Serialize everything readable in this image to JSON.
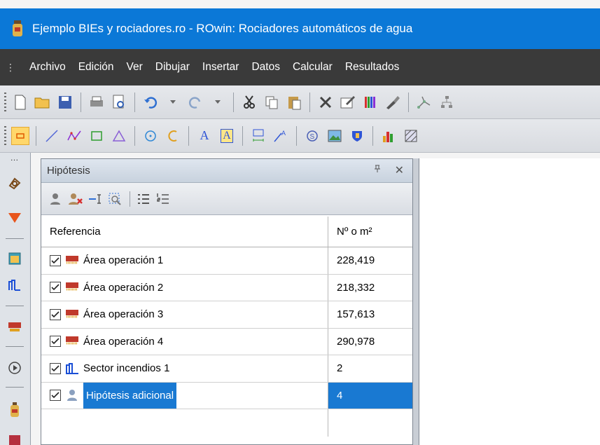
{
  "window": {
    "title": "Ejemplo BIEs y rociadores.ro - ROwin: Rociadores automáticos de agua",
    "icon": "app-extinguisher-icon"
  },
  "menu": {
    "items": [
      "Archivo",
      "Edición",
      "Ver",
      "Dibujar",
      "Insertar",
      "Datos",
      "Calcular",
      "Resultados"
    ]
  },
  "toolbar1": {
    "icons": [
      "new-file-icon",
      "open-folder-icon",
      "save-icon",
      "print-icon",
      "print-preview-icon",
      "undo-icon",
      "redo-icon",
      "cut-icon",
      "copy-icon",
      "paste-icon",
      "delete-icon",
      "edit-icon",
      "colors-icon",
      "brush-icon",
      "network-icon"
    ]
  },
  "toolbar2": {
    "icons": [
      "select-icon",
      "line-icon",
      "polyline-icon",
      "rectangle-icon",
      "triangle-icon",
      "circle-icon",
      "arc-icon",
      "text-icon",
      "text-box-icon",
      "dimension-icon",
      "measure-icon",
      "symbol-icon",
      "image-icon",
      "shield-icon",
      "chart-icon",
      "hatch-icon"
    ]
  },
  "dock": {
    "icons": [
      "layers-icon",
      "funnel-icon",
      "window-icon",
      "sector-icon",
      "operation-area-icon",
      "play-icon",
      "extinguisher-icon",
      "panel-icon"
    ]
  },
  "panel": {
    "title": "Hipótesis",
    "pin": "ᵖ",
    "close": "✕",
    "toolbar_icons": [
      "add-user-icon",
      "remove-user-icon",
      "insert-icon",
      "zoom-selection-icon",
      "list-icon",
      "numbered-list-icon"
    ],
    "columns": [
      "Referencia",
      "Nº o m²"
    ],
    "rows": [
      {
        "label": "Área operación 1",
        "value": "228,419",
        "icon": "operation-area-icon",
        "selected": false
      },
      {
        "label": "Área operación 2",
        "value": "218,332",
        "icon": "operation-area-icon",
        "selected": false
      },
      {
        "label": "Área operación 3",
        "value": "157,613",
        "icon": "operation-area-icon",
        "selected": false
      },
      {
        "label": "Área operación 4",
        "value": "290,978",
        "icon": "operation-area-icon",
        "selected": false
      },
      {
        "label": "Sector incendios 1",
        "value": "2",
        "icon": "sector-icon",
        "selected": false
      },
      {
        "label": "Hipótesis adicional",
        "value": "4",
        "icon": "user-icon",
        "selected": true
      }
    ]
  },
  "colors": {
    "titlebar": "#0b78d7",
    "menubar": "#3a3a3a",
    "selection": "#1979d2"
  }
}
